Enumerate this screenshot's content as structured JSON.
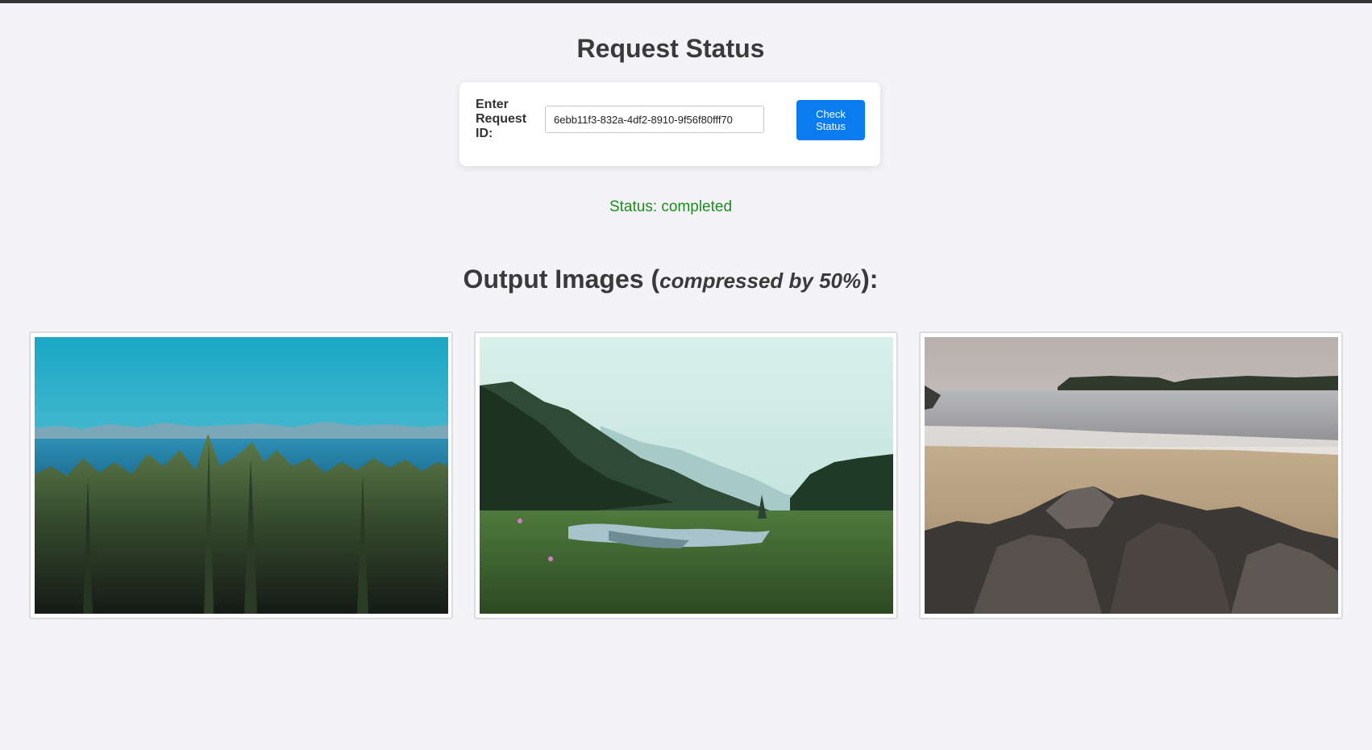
{
  "header": {
    "title": "Request Status"
  },
  "form": {
    "label": "Enter Request ID:",
    "input_value": "6ebb11f3-832a-4df2-8910-9f56f80fff70",
    "button_label": "Check Status"
  },
  "status": {
    "text": "Status: completed",
    "color": "#1f8a1f"
  },
  "output": {
    "title_prefix": "Output Images (",
    "title_emphasis": "compressed by 50%",
    "title_suffix": "):",
    "images": [
      {
        "icon": "forest-coast-landscape"
      },
      {
        "icon": "misty-river-valley-landscape"
      },
      {
        "icon": "rocky-beach-landscape"
      }
    ]
  },
  "colors": {
    "button": "#0a7cf0",
    "background": "#f4f4f8"
  }
}
